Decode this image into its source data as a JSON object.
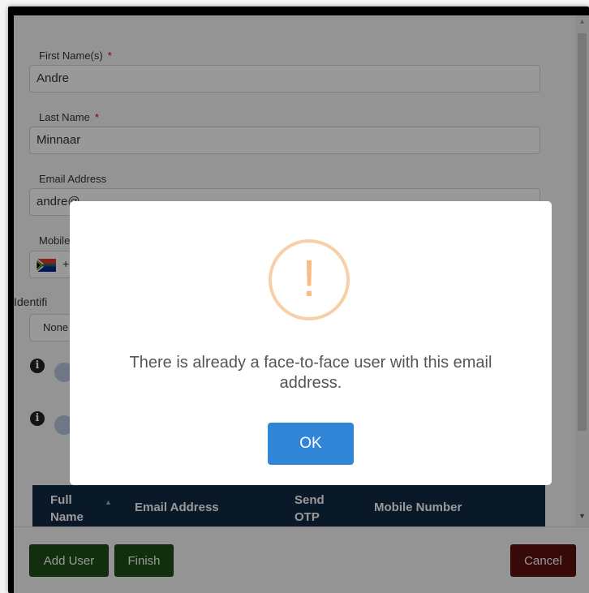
{
  "form": {
    "first_name_label": "First Name(s)",
    "first_name_value": "Andre",
    "last_name_label": "Last Name",
    "last_name_value": "Minnaar",
    "email_label": "Email Address",
    "email_value": "andre@...",
    "mobile_label": "Mobile",
    "mobile_prefix": "+",
    "identification_label": "Identifi",
    "identification_value": "None",
    "required_marker": "*"
  },
  "table": {
    "headers": [
      "Full Name",
      "Email Address",
      "Send OTP",
      "Mobile Number"
    ],
    "full_name_line1": "Full",
    "full_name_line2": "Name",
    "send_otp_line1": "Send",
    "send_otp_line2": "OTP"
  },
  "footer": {
    "add_user_label": "Add User",
    "finish_label": "Finish",
    "cancel_label": "Cancel"
  },
  "dialog": {
    "icon": "warning-icon",
    "icon_glyph": "!",
    "message": "There is already a face-to-face user with this email address.",
    "ok_label": "OK"
  },
  "colors": {
    "primary_green": "#1f4f16",
    "cancel_red": "#5c0f0f",
    "ok_blue": "#3085d6",
    "table_header": "#0f2a44",
    "warning": "#f8bb86"
  }
}
